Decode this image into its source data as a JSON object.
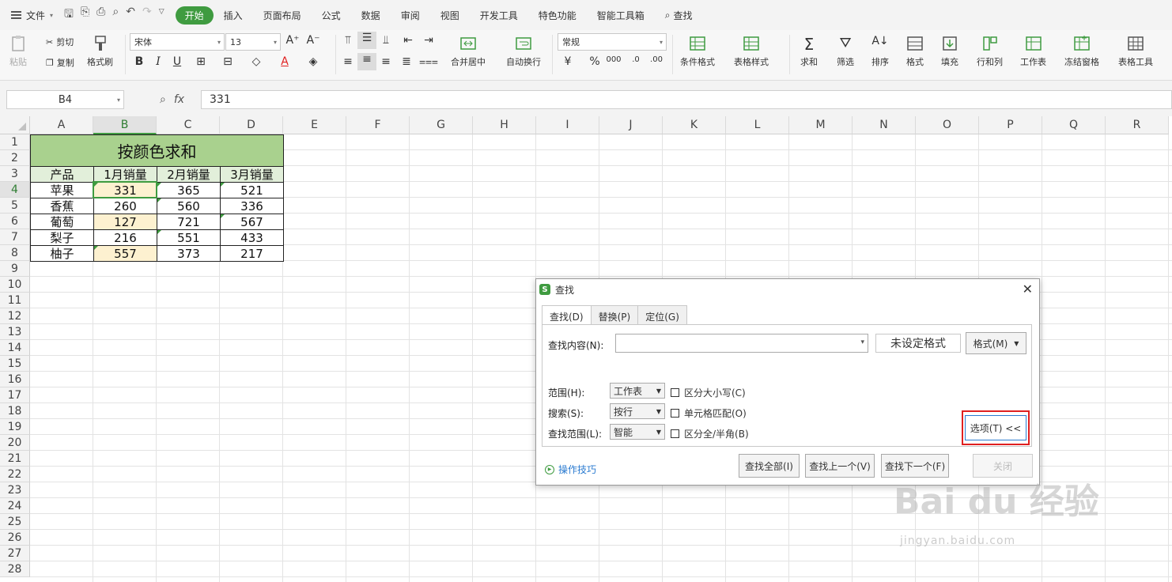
{
  "menubar": {
    "file_label": "文件",
    "tabs": [
      {
        "label": "开始",
        "active": true
      },
      {
        "label": "插入"
      },
      {
        "label": "页面布局"
      },
      {
        "label": "公式"
      },
      {
        "label": "数据"
      },
      {
        "label": "审阅"
      },
      {
        "label": "视图"
      },
      {
        "label": "开发工具"
      },
      {
        "label": "特色功能"
      },
      {
        "label": "智能工具箱"
      }
    ],
    "search_label": "查找"
  },
  "ribbon": {
    "paste": "粘贴",
    "cut": "剪切",
    "copy": "复制",
    "format_painter": "格式刷",
    "font_name": "宋体",
    "font_size": "13",
    "number_format": "常规",
    "merge": "合并居中",
    "wrap": "自动换行",
    "cond_format": "条件格式",
    "table_style": "表格样式",
    "sum": "求和",
    "filter": "筛选",
    "sort": "排序",
    "format": "格式",
    "fill": "填充",
    "row_col": "行和列",
    "worksheet": "工作表",
    "freeze": "冻结窗格",
    "table_tools": "表格工具",
    "accent": "#3f9b40"
  },
  "formula_bar": {
    "cell_ref": "B4",
    "fx": "fx",
    "value": "331"
  },
  "grid": {
    "columns": [
      "A",
      "B",
      "C",
      "D",
      "E",
      "F",
      "G",
      "H",
      "I",
      "J",
      "K",
      "L",
      "M",
      "N",
      "O",
      "P",
      "Q",
      "R"
    ],
    "rows": [
      "1",
      "2",
      "3",
      "4",
      "5",
      "6",
      "7",
      "8",
      "9",
      "10",
      "11",
      "12",
      "13",
      "14",
      "15",
      "16",
      "17",
      "18",
      "19",
      "20",
      "21",
      "22",
      "23",
      "24",
      "25",
      "26",
      "27",
      "28"
    ],
    "selected_column": "B",
    "selected_row": "4"
  },
  "sheet": {
    "title": "按颜色求和",
    "headers": [
      "产品",
      "1月销量",
      "2月销量",
      "3月销量"
    ],
    "rows": [
      {
        "product": "苹果",
        "m1": "331",
        "m2": "365",
        "m3": "521",
        "hl": true
      },
      {
        "product": "香蕉",
        "m1": "260",
        "m2": "560",
        "m3": "336",
        "hl": false
      },
      {
        "product": "葡萄",
        "m1": "127",
        "m2": "721",
        "m3": "567",
        "hl": true
      },
      {
        "product": "梨子",
        "m1": "216",
        "m2": "551",
        "m3": "433",
        "hl": false
      },
      {
        "product": "柚子",
        "m1": "557",
        "m2": "373",
        "m3": "217",
        "hl": true
      }
    ],
    "title_color": "#a9d18e",
    "header_color": "#e2efda",
    "highlight_color": "#fdf1d0"
  },
  "dialog": {
    "title": "查找",
    "tabs": [
      "查找(D)",
      "替换(P)",
      "定位(G)"
    ],
    "find_label": "查找内容(N):",
    "find_value": "",
    "no_format": "未设定格式",
    "format_button": "格式(M)",
    "scope_label": "范围(H):",
    "scope_value": "工作表",
    "search_label": "搜索(S):",
    "search_value": "按行",
    "lookin_label": "查找范围(L):",
    "lookin_value": "智能",
    "match_case": "区分大小写(C)",
    "match_cell": "单元格匹配(O)",
    "match_width": "区分全/半角(B)",
    "options_button": "选项(T) <<",
    "tips": "操作技巧",
    "find_all": "查找全部(I)",
    "find_prev": "查找上一个(V)",
    "find_next": "查找下一个(F)",
    "close": "关闭"
  },
  "watermark": {
    "logo": "Bai du 经验",
    "url": "jingyan.baidu.com"
  }
}
